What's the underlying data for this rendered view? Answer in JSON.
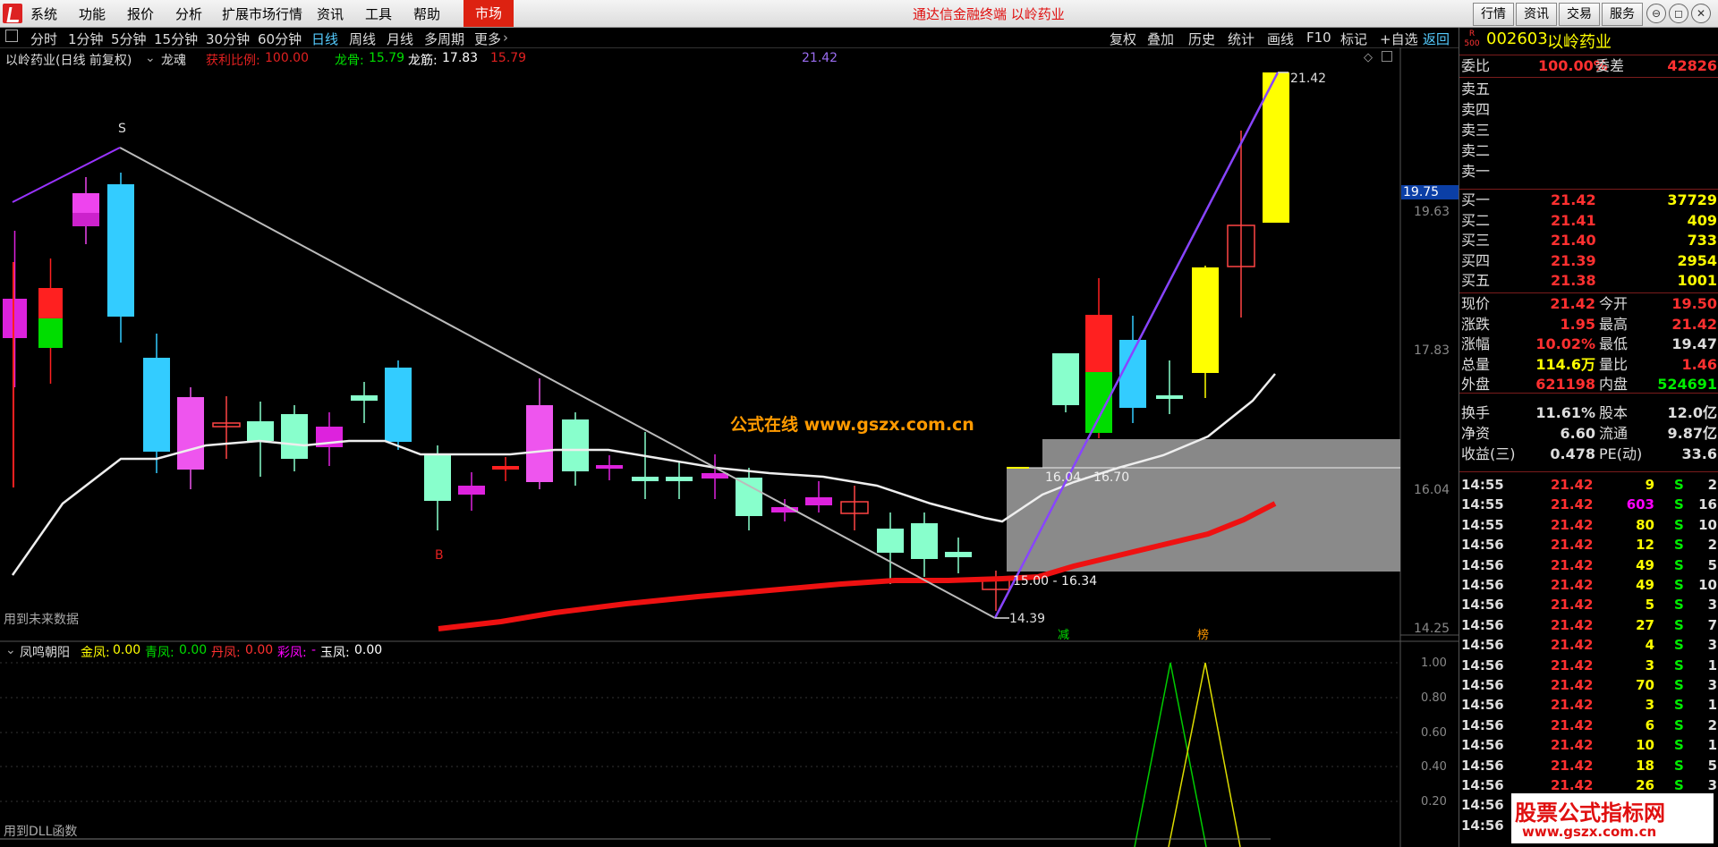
{
  "menu": {
    "items": [
      "系统",
      "功能",
      "报价",
      "分析",
      "扩展市场行情",
      "资讯",
      "工具",
      "帮助"
    ],
    "market_tab": "市场",
    "window_title": "通达信金融终端 以岭药业",
    "right_buttons": [
      "行情",
      "资讯",
      "交易",
      "服务"
    ]
  },
  "periods": {
    "items": [
      "分时",
      "1分钟",
      "5分钟",
      "15分钟",
      "30分钟",
      "60分钟",
      "日线",
      "周线",
      "月线",
      "多周期",
      "更多"
    ],
    "active": "日线",
    "tools": [
      "复权",
      "叠加",
      "历史",
      "统计",
      "画线",
      "F10",
      "标记",
      "+自选",
      "返回"
    ]
  },
  "main_chart": {
    "title": "以岭药业(日线 前复权)",
    "indicator": "龙魂",
    "profit_label": "获利比例:",
    "profit_value": "100.00",
    "longgu_label": "龙骨:",
    "longgu_value": "15.79",
    "longjin_label": "龙筋:",
    "longjin_value": "17.83",
    "extra_value": "15.79",
    "top_value": "21.42",
    "future_note": "用到未来数据",
    "watermark": "公式在线 www.gszx.com.cn",
    "price_high_label": "21.42",
    "price_low_label": "14.39",
    "band1_label": "16.04 - 16.70",
    "band2_label": "15.00 - 16.34",
    "signal_s": "S",
    "signal_b": "B",
    "tag_jian": "减",
    "tag_bang": "榜",
    "axis_labels": [
      "19.63",
      "17.83",
      "16.04",
      "14.25"
    ],
    "axis_current": "19.75"
  },
  "sub_chart": {
    "title": "凤鸣朝阳",
    "fields": [
      {
        "label": "金凤:",
        "value": "0.00",
        "color": "#ffff00"
      },
      {
        "label": "青凤:",
        "value": "0.00",
        "color": "#00dd00"
      },
      {
        "label": "丹凤:",
        "value": "0.00",
        "color": "#ff3030"
      },
      {
        "label": "彩凤:",
        "value": "-",
        "color": "#ff00ff"
      },
      {
        "label": "玉凤:",
        "value": "0.00",
        "color": "#ffffff"
      }
    ],
    "dll_note": "用到DLL函数",
    "axis_labels": [
      "1.00",
      "0.80",
      "0.60",
      "0.40",
      "0.20"
    ]
  },
  "quote": {
    "code": "002603",
    "name": "以岭药业",
    "weibi_label": "委比",
    "weibi_value": "100.00%",
    "weicha_label": "委差",
    "weicha_value": "42826",
    "sells": [
      "卖五",
      "卖四",
      "卖三",
      "卖二",
      "卖一"
    ],
    "buys": [
      {
        "label": "买一",
        "price": "21.42",
        "vol": "37729"
      },
      {
        "label": "买二",
        "price": "21.41",
        "vol": "409"
      },
      {
        "label": "买三",
        "price": "21.40",
        "vol": "733"
      },
      {
        "label": "买四",
        "price": "21.39",
        "vol": "2954"
      },
      {
        "label": "买五",
        "price": "21.38",
        "vol": "1001"
      }
    ],
    "stats": [
      {
        "l1": "现价",
        "v1": "21.42",
        "l2": "今开",
        "v2": "19.50",
        "c1": "#ff3030",
        "c2": "#ff3030"
      },
      {
        "l1": "涨跌",
        "v1": "1.95",
        "l2": "最高",
        "v2": "21.42",
        "c1": "#ff3030",
        "c2": "#ff3030"
      },
      {
        "l1": "涨幅",
        "v1": "10.02%",
        "l2": "最低",
        "v2": "19.47",
        "c1": "#ff3030",
        "c2": "#dddddd"
      },
      {
        "l1": "总量",
        "v1": "114.6万",
        "l2": "量比",
        "v2": "1.46",
        "c1": "#ffff00",
        "c2": "#ff3030"
      },
      {
        "l1": "外盘",
        "v1": "621198",
        "l2": "内盘",
        "v2": "524691",
        "c1": "#ff3030",
        "c2": "#00ee00"
      }
    ],
    "stats2": [
      {
        "l1": "换手",
        "v1": "11.61%",
        "l2": "股本",
        "v2": "12.0亿"
      },
      {
        "l1": "净资",
        "v1": "6.60",
        "l2": "流通",
        "v2": "9.87亿"
      },
      {
        "l1": "收益(三)",
        "v1": "0.478",
        "l2": "PE(动)",
        "v2": "33.6"
      }
    ],
    "ticks": [
      {
        "t": "14:55",
        "p": "21.42",
        "v": "9",
        "s": "S",
        "n": "2",
        "vc": "#ffff00"
      },
      {
        "t": "14:55",
        "p": "21.42",
        "v": "603",
        "s": "S",
        "n": "16",
        "vc": "#ff00ff"
      },
      {
        "t": "14:55",
        "p": "21.42",
        "v": "80",
        "s": "S",
        "n": "10",
        "vc": "#ffff00"
      },
      {
        "t": "14:56",
        "p": "21.42",
        "v": "12",
        "s": "S",
        "n": "2",
        "vc": "#ffff00"
      },
      {
        "t": "14:56",
        "p": "21.42",
        "v": "49",
        "s": "S",
        "n": "5",
        "vc": "#ffff00"
      },
      {
        "t": "14:56",
        "p": "21.42",
        "v": "49",
        "s": "S",
        "n": "10",
        "vc": "#ffff00"
      },
      {
        "t": "14:56",
        "p": "21.42",
        "v": "5",
        "s": "S",
        "n": "3",
        "vc": "#ffff00"
      },
      {
        "t": "14:56",
        "p": "21.42",
        "v": "27",
        "s": "S",
        "n": "7",
        "vc": "#ffff00"
      },
      {
        "t": "14:56",
        "p": "21.42",
        "v": "4",
        "s": "S",
        "n": "3",
        "vc": "#ffff00"
      },
      {
        "t": "14:56",
        "p": "21.42",
        "v": "3",
        "s": "S",
        "n": "1",
        "vc": "#ffff00"
      },
      {
        "t": "14:56",
        "p": "21.42",
        "v": "70",
        "s": "S",
        "n": "3",
        "vc": "#ffff00"
      },
      {
        "t": "14:56",
        "p": "21.42",
        "v": "3",
        "s": "S",
        "n": "1",
        "vc": "#ffff00"
      },
      {
        "t": "14:56",
        "p": "21.42",
        "v": "6",
        "s": "S",
        "n": "2",
        "vc": "#ffff00"
      },
      {
        "t": "14:56",
        "p": "21.42",
        "v": "10",
        "s": "S",
        "n": "1",
        "vc": "#ffff00"
      },
      {
        "t": "14:56",
        "p": "21.42",
        "v": "18",
        "s": "S",
        "n": "5",
        "vc": "#ffff00"
      },
      {
        "t": "14:56",
        "p": "21.42",
        "v": "26",
        "s": "S",
        "n": "3",
        "vc": "#ffff00"
      },
      {
        "t": "14:56",
        "p": "",
        "v": "",
        "s": "",
        "n": "",
        "vc": "#ffff00"
      },
      {
        "t": "14:56",
        "p": "",
        "v": "",
        "s": "",
        "n": "",
        "vc": "#ffff00"
      }
    ],
    "bottom_logo": "股票公式指标网",
    "bottom_url": "www.gszx.com.cn"
  },
  "colors": {
    "up": "#ff3030",
    "down": "#00ee00",
    "accent_blue": "#55ccff",
    "menu_red": "#dd2211"
  }
}
